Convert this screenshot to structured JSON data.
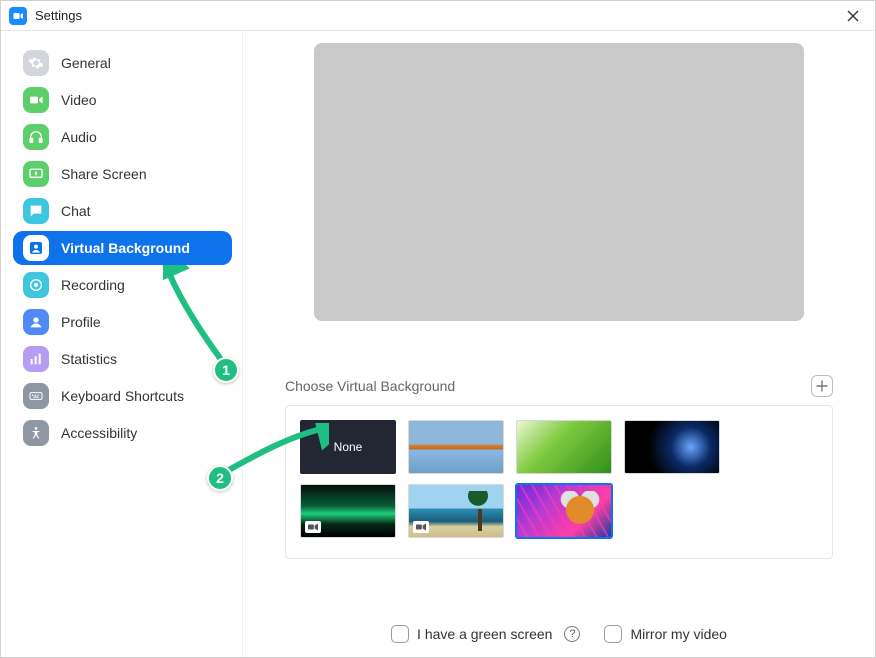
{
  "window": {
    "title": "Settings"
  },
  "sidebar": {
    "items": [
      {
        "label": "General",
        "icon": "gear",
        "color": "#d3d6dc",
        "active": false
      },
      {
        "label": "Video",
        "icon": "video",
        "color": "#5ccf6a",
        "active": false
      },
      {
        "label": "Audio",
        "icon": "audio",
        "color": "#5ccf6a",
        "active": false
      },
      {
        "label": "Share Screen",
        "icon": "share",
        "color": "#5ccf6a",
        "active": false
      },
      {
        "label": "Chat",
        "icon": "chat",
        "color": "#3ec6e0",
        "active": false
      },
      {
        "label": "Virtual Background",
        "icon": "vb",
        "color": "#0e72ed",
        "active": true
      },
      {
        "label": "Recording",
        "icon": "record",
        "color": "#3ec6e0",
        "active": false
      },
      {
        "label": "Profile",
        "icon": "profile",
        "color": "#4f8af8",
        "active": false
      },
      {
        "label": "Statistics",
        "icon": "stats",
        "color": "#b69cf3",
        "active": false
      },
      {
        "label": "Keyboard Shortcuts",
        "icon": "keyboard",
        "color": "#8f97a3",
        "active": false
      },
      {
        "label": "Accessibility",
        "icon": "accessibility",
        "color": "#8f97a3",
        "active": false
      }
    ]
  },
  "main": {
    "section_title": "Choose Virtual Background",
    "add_button_title": "Add image or video",
    "thumbnails": [
      {
        "id": "none",
        "label": "None",
        "kind": "none",
        "selected": false
      },
      {
        "id": "bridge",
        "label": "",
        "kind": "image",
        "selected": false
      },
      {
        "id": "grass",
        "label": "",
        "kind": "image",
        "selected": false
      },
      {
        "id": "earth",
        "label": "",
        "kind": "image",
        "selected": false
      },
      {
        "id": "aurora",
        "label": "",
        "kind": "video",
        "selected": false
      },
      {
        "id": "beach",
        "label": "",
        "kind": "video",
        "selected": false
      },
      {
        "id": "tiger",
        "label": "",
        "kind": "image",
        "selected": true
      }
    ],
    "options": {
      "green_screen_label": "I have a green screen",
      "mirror_label": "Mirror my video"
    }
  },
  "annotations": {
    "badge1": "1",
    "badge2": "2"
  }
}
